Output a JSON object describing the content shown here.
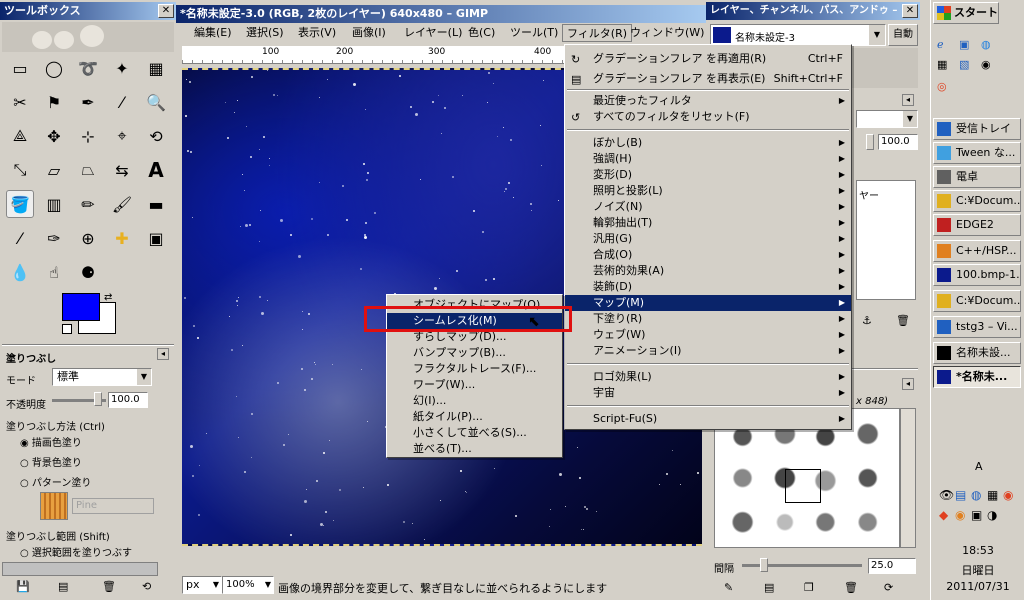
{
  "toolbox": {
    "title": "ツールボックス",
    "fill_title": "塗りつぶし",
    "mode_label": "モード",
    "mode_value": "標準",
    "opacity_label": "不透明度",
    "opacity_value": "100.0",
    "fill_type_label": "塗りつぶし方法 (Ctrl)",
    "fill_types": [
      "描画色塗り",
      "背景色塗り",
      "パターン塗り"
    ],
    "pattern_name": "Pine",
    "fill_area_label": "塗りつぶし範囲 (Shift)",
    "fill_area_option": "選択範囲を塗りつぶす",
    "fg_color": "#0000ff",
    "bg_color": "#ffffff"
  },
  "image_window": {
    "title": "*名称未設定-3.0 (RGB, 2枚のレイヤー) 640x480 – GIMP",
    "menus": [
      "編集(E)",
      "選択(S)",
      "表示(V)",
      "画像(I)",
      "レイヤー(L)",
      "色(C)",
      "ツール(T)",
      "フィルタ(R)",
      "ウィンドウ(W)"
    ],
    "ruler_marks": [
      "100",
      "200",
      "300",
      "400"
    ],
    "status_unit": "px",
    "zoom": "100%",
    "status_text": "画像の境界部分を変更して、繋ぎ目なしに並べられるようにします"
  },
  "filter_menu": {
    "items": [
      {
        "label": "グラデーションフレア を再適用(R)",
        "shortcut": "Ctrl+F"
      },
      {
        "label": "グラデーションフレア を再表示(E)",
        "shortcut": "Shift+Ctrl+F"
      },
      {
        "label": "最近使ったフィルタ",
        "shortcut": ""
      },
      {
        "label": "すべてのフィルタをリセット(F)",
        "shortcut": ""
      },
      {
        "label": "ぼかし(B)",
        "shortcut": ""
      },
      {
        "label": "強調(H)",
        "shortcut": ""
      },
      {
        "label": "変形(D)",
        "shortcut": ""
      },
      {
        "label": "照明と投影(L)",
        "shortcut": ""
      },
      {
        "label": "ノイズ(N)",
        "shortcut": ""
      },
      {
        "label": "輪郭抽出(T)",
        "shortcut": ""
      },
      {
        "label": "汎用(G)",
        "shortcut": ""
      },
      {
        "label": "合成(O)",
        "shortcut": ""
      },
      {
        "label": "芸術的効果(A)",
        "shortcut": ""
      },
      {
        "label": "装飾(D)",
        "shortcut": ""
      },
      {
        "label": "マップ(M)",
        "shortcut": ""
      },
      {
        "label": "下塗り(R)",
        "shortcut": ""
      },
      {
        "label": "ウェブ(W)",
        "shortcut": ""
      },
      {
        "label": "アニメーション(I)",
        "shortcut": ""
      },
      {
        "label": "ロゴ効果(L)",
        "shortcut": ""
      },
      {
        "label": "宇宙",
        "shortcut": ""
      },
      {
        "label": "Script-Fu(S)",
        "shortcut": ""
      }
    ]
  },
  "map_submenu": {
    "items": [
      "オブジェクトにマップ(O)...",
      "シームレス化(M)",
      "すらしマップ(D)...",
      "バンプマップ(B)...",
      "フラクタルトレース(F)...",
      "ワープ(W)...",
      "幻(I)...",
      "紙タイル(P)...",
      "小さくして並べる(S)...",
      "並べる(T)..."
    ]
  },
  "layers_dock": {
    "title": "レイヤー、チャンネル、パス、アンドゥ –",
    "image_name": "名称未設定-3",
    "auto_button": "自動",
    "opacity_value": "100.0",
    "layer_label": "ヤー",
    "brush_info": "x 848)",
    "spacing_label": "間隔",
    "spacing_value": "25.0"
  },
  "taskbar": {
    "start": "スタート",
    "buttons": [
      "受信トレイ",
      "Tween な...",
      "電卓",
      "C:¥Docum...",
      "EDGE2",
      "C++/HSP...",
      "100.bmp-1...",
      "C:¥Docum...",
      "tstg3 – Vi...",
      "名称未設...",
      "*名称未..."
    ],
    "lang": "A",
    "time": "18:53",
    "day": "日曜日",
    "date": "2011/07/31"
  }
}
